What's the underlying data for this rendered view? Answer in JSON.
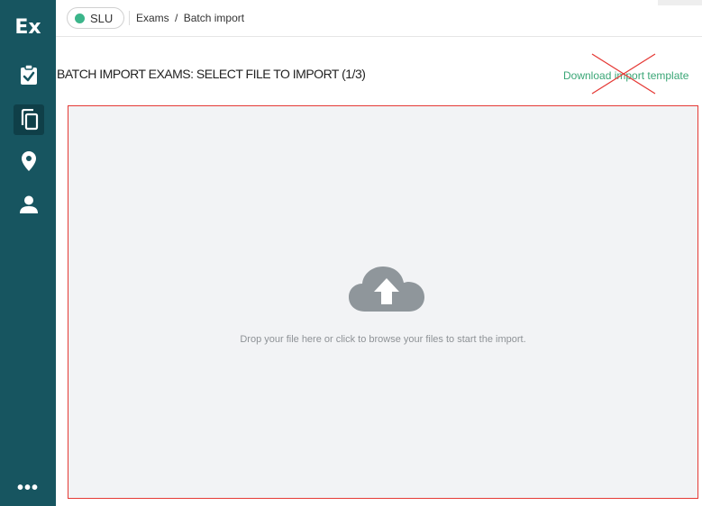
{
  "app": {
    "logo": "Ex"
  },
  "sidebar": {
    "items": [
      {
        "name": "exams",
        "icon": "clipboard-check-icon",
        "active": false
      },
      {
        "name": "batch-import",
        "icon": "copy-icon",
        "active": true
      },
      {
        "name": "locations",
        "icon": "map-pin-icon",
        "active": false
      },
      {
        "name": "users",
        "icon": "person-icon",
        "active": false
      }
    ],
    "more_label": "•••"
  },
  "header": {
    "org": {
      "label": "SLU",
      "status_color": "#3bb58a"
    },
    "breadcrumb": {
      "parent": "Exams",
      "separator": "/",
      "current": "Batch import"
    }
  },
  "main": {
    "title": "BATCH IMPORT EXAMS: SELECT FILE TO IMPORT (1/3)",
    "download_template_label": "Download import template",
    "dropzone": {
      "icon": "cloud-upload-icon",
      "text": "Drop your file here or click to browse your files to start the import."
    }
  },
  "colors": {
    "sidebar": "#175560",
    "accent_green": "#3aa676",
    "highlight_red": "#e53935",
    "dropzone_bg": "#f2f3f5"
  }
}
